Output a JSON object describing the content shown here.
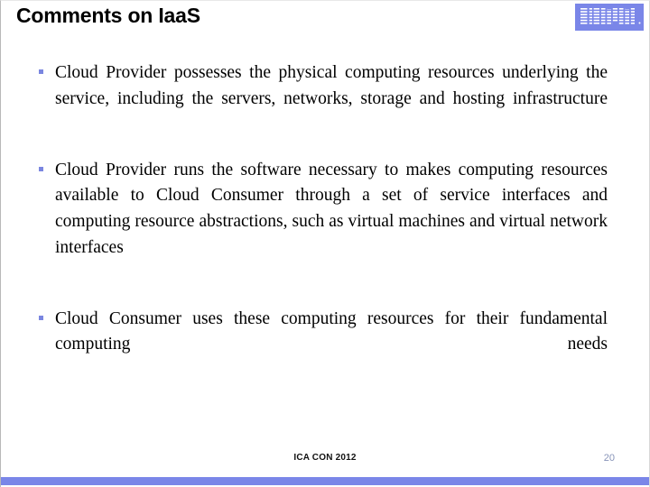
{
  "slide": {
    "title": "Comments on IaaS",
    "logo": {
      "name": "ibm-logo",
      "text": "IBM",
      "color": "#7a86e8",
      "stripe_color": "#ffffff"
    },
    "bullets": [
      {
        "marker": "square-bullet",
        "text": "Cloud Provider possesses the physical computing resources underlying the service, including the servers, networks, storage and hosting infrastructure"
      },
      {
        "marker": "square-bullet",
        "text": "Cloud Provider runs the software necessary to makes computing resources available to Cloud Consumer through a set of service interfaces and computing resource abstractions, such as virtual machines and virtual network interfaces"
      },
      {
        "marker": "square-bullet",
        "text": "Cloud Consumer uses these computing resources for their fundamental computing needs"
      }
    ],
    "footer": {
      "conference": "ICA CON 2012",
      "page_number": "20"
    },
    "colors": {
      "accent_blue": "#7a86e8",
      "bullet_blue": "#7a86e0",
      "page_number": "#8793b8",
      "text": "#000000",
      "background": "#ffffff"
    }
  }
}
